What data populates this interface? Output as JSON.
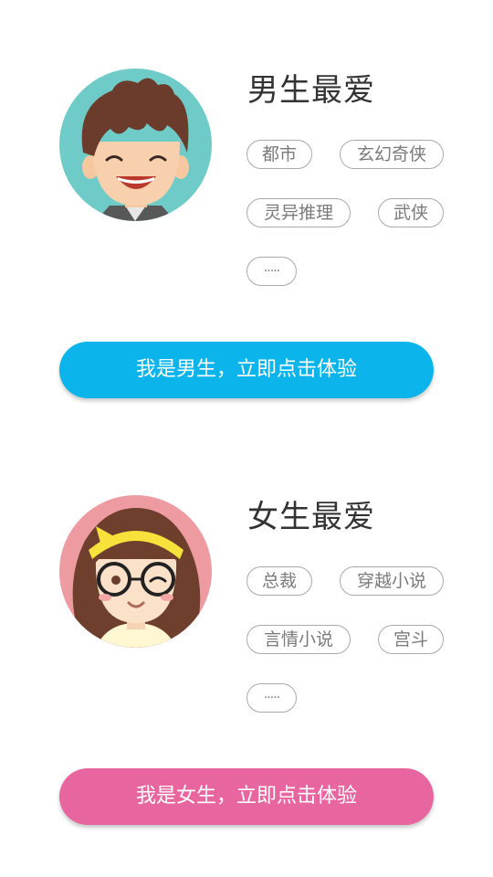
{
  "theme": {
    "boy_button_color": "#0bb4ea",
    "girl_button_color": "#e8669f",
    "tag_border_color": "#a9a9a9",
    "tag_text_color": "#7a7a7a",
    "title_color": "#333333"
  },
  "boy": {
    "avatar_icon": "boy-avatar",
    "title": "男生最爱",
    "tags": [
      "都市",
      "玄幻奇侠",
      "灵异推理",
      "武侠",
      "·····"
    ],
    "cta_label": "我是男生，立即点击体验"
  },
  "girl": {
    "avatar_icon": "girl-avatar",
    "title": "女生最爱",
    "tags": [
      "总裁",
      "穿越小说",
      "言情小说",
      "宫斗",
      "·····"
    ],
    "cta_label": "我是女生，立即点击体验"
  }
}
